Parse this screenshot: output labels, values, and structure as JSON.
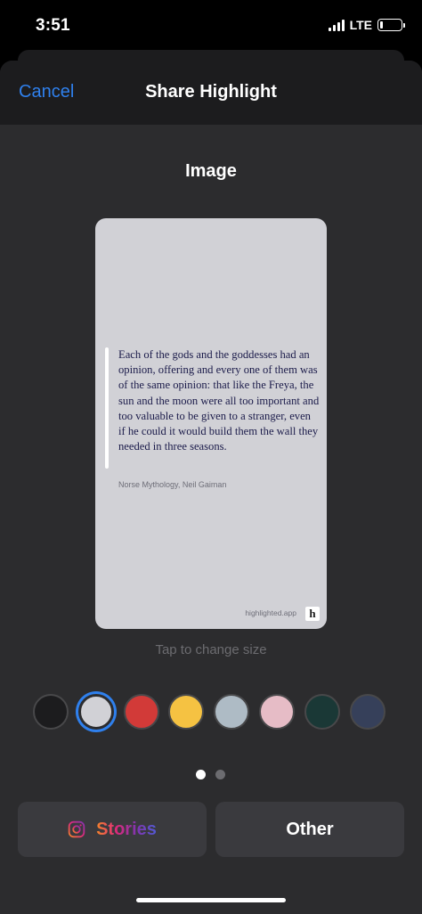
{
  "status_bar": {
    "time": "3:51",
    "network": "LTE",
    "battery_level": 0.15
  },
  "nav": {
    "cancel_label": "Cancel",
    "title": "Share Highlight"
  },
  "section_title": "Image",
  "card": {
    "quote": "Each of the gods and the goddesses had an opinion, offering and every one of them was of the same opinion: that like the Freya, the sun and the moon were all too important and too valuable to be given to a stranger, even if he could it would build them the wall they needed in three seasons.",
    "source": "Norse Mythology, Neil Gaiman",
    "watermark": "highlighted.app",
    "logo_letter": "h",
    "background_color": "#d1d1d6",
    "text_color": "#1b1b4a"
  },
  "size_hint": "Tap to change size",
  "colors": [
    {
      "name": "black",
      "hex": "#1c1c1e",
      "selected": false
    },
    {
      "name": "light-gray",
      "hex": "#d1d1d6",
      "selected": true
    },
    {
      "name": "red",
      "hex": "#d23a38",
      "selected": false
    },
    {
      "name": "yellow",
      "hex": "#f5c242",
      "selected": false
    },
    {
      "name": "blue-gray",
      "hex": "#aebbc5",
      "selected": false
    },
    {
      "name": "pink",
      "hex": "#e6bcc6",
      "selected": false
    },
    {
      "name": "dark-teal",
      "hex": "#1a3836",
      "selected": false
    },
    {
      "name": "navy",
      "hex": "#36405a",
      "selected": false
    }
  ],
  "pages": {
    "count": 2,
    "current": 0
  },
  "actions": {
    "stories_label": "Stories",
    "other_label": "Other"
  },
  "theme": {
    "accent": "#2f80ed"
  }
}
